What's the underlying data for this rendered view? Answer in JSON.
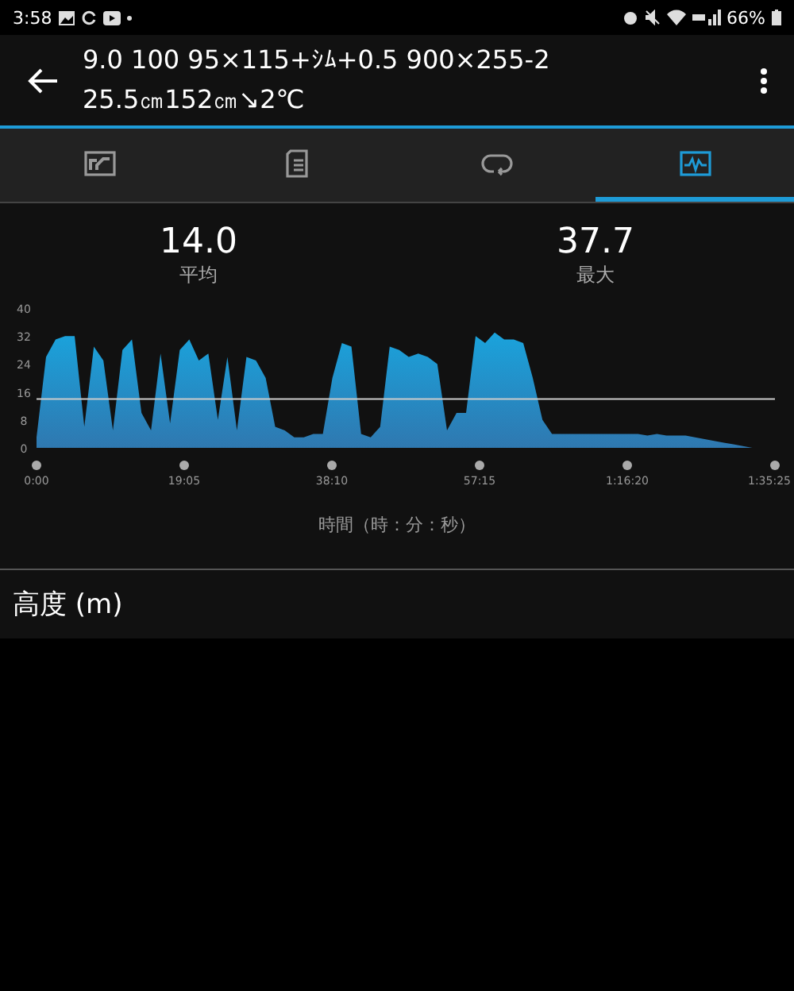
{
  "status_bar": {
    "time": "3:58",
    "battery": "66%"
  },
  "app_bar": {
    "title_line_1": "9.0 100 95×115+ｼﾑ+0.5 900×255-2",
    "title_line_2": "25.5㎝152㎝↘2℃"
  },
  "tabs": [
    {
      "kind": "summary",
      "selected": false
    },
    {
      "kind": "details",
      "selected": false
    },
    {
      "kind": "laps",
      "selected": false
    },
    {
      "kind": "charts",
      "selected": true
    }
  ],
  "stats": [
    {
      "value": "14.0",
      "label": "平均"
    },
    {
      "value": "37.7",
      "label": "最大"
    }
  ],
  "chart_data": {
    "type": "area",
    "xlabel": "時間（時：分：秒）",
    "xlim": [
      0,
      5725
    ],
    "ylim": [
      0,
      40
    ],
    "yticks": [
      0,
      8,
      16,
      24,
      32,
      40
    ],
    "xticks": [
      {
        "value": 0,
        "label": "0:00"
      },
      {
        "value": 1145,
        "label": "19:05"
      },
      {
        "value": 2290,
        "label": "38:10"
      },
      {
        "value": 3435,
        "label": "57:15"
      },
      {
        "value": 4580,
        "label": "1:16:20"
      },
      {
        "value": 5725,
        "label": "1:35:25"
      }
    ],
    "ref_lines": [
      {
        "value": 14.0,
        "axis": "y"
      }
    ],
    "x": [
      0,
      74,
      148,
      222,
      296,
      370,
      444,
      518,
      592,
      666,
      740,
      814,
      888,
      962,
      1036,
      1110,
      1184,
      1258,
      1332,
      1406,
      1480,
      1554,
      1628,
      1702,
      1776,
      1850,
      1924,
      1998,
      2072,
      2146,
      2220,
      2294,
      2368,
      2442,
      2516,
      2590,
      2664,
      2738,
      2812,
      2886,
      2960,
      3034,
      3108,
      3182,
      3256,
      3330,
      3404,
      3478,
      3552,
      3626,
      3700,
      3774,
      3848,
      3922,
      3996,
      4070,
      4144,
      4218,
      4292,
      4366,
      4440,
      4514,
      4588,
      4662,
      4736,
      4810,
      4884,
      4958,
      5032,
      5106,
      5180,
      5254,
      5328,
      5402,
      5476,
      5550
    ],
    "series": [
      {
        "color": "#1aa3dc",
        "values": [
          3,
          26,
          31,
          32,
          32,
          6,
          29,
          25,
          5,
          28,
          31,
          10,
          5,
          27,
          7,
          28,
          31,
          25,
          27,
          8,
          26,
          5,
          26,
          25,
          20,
          6,
          5,
          3,
          3,
          4,
          4,
          20,
          30,
          29,
          4,
          3,
          6,
          29,
          28,
          26,
          27,
          26,
          24,
          5,
          10,
          10,
          32,
          30,
          33,
          31,
          31,
          30,
          20,
          8,
          4,
          4,
          4,
          4,
          4,
          4,
          4,
          4,
          4,
          4,
          3.5,
          4,
          3.5,
          3.5,
          3.5,
          3,
          2.5,
          2,
          1.5,
          1,
          0.5,
          0
        ]
      }
    ]
  },
  "next_section": {
    "title": "高度 (m)"
  }
}
